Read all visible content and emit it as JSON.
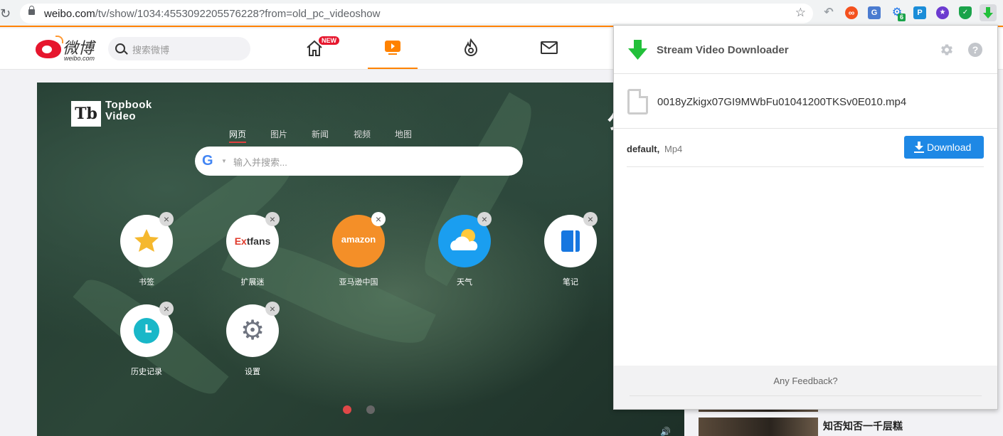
{
  "browser": {
    "url_host": "weibo.com",
    "url_path": "/tv/show/1034:4553092205576228?from=old_pc_videoshow",
    "extensions": [
      {
        "name": "back-arrow-icon",
        "color": "#9aa0a6"
      },
      {
        "name": "infinity-icon",
        "color": "#f4511e"
      },
      {
        "name": "translate-icon",
        "color": "#4a7bd0"
      },
      {
        "name": "gear-badge-icon",
        "color": "#1a73e8",
        "badge": "6"
      },
      {
        "name": "p-extension-icon",
        "color": "#1a8dd8",
        "text": "P"
      },
      {
        "name": "star-extension-icon",
        "color": "#6c3bd0"
      },
      {
        "name": "shield-extension-icon",
        "color": "#1aa34a"
      },
      {
        "name": "stream-downloader-icon",
        "color": "#22c03a"
      }
    ]
  },
  "weibo": {
    "logo_text": "微博",
    "logo_sub": "weibo.com",
    "search_placeholder": "搜索微博",
    "new_badge": "NEW"
  },
  "video": {
    "brand_line1": "Topbook",
    "brand_line2": "Video",
    "brand_logo": "Tb",
    "clipped_text": "匀",
    "tabs": [
      "网页",
      "图片",
      "新闻",
      "视频",
      "地图"
    ],
    "search_placeholder": "输入并搜索...",
    "tiles": [
      {
        "label": "书签",
        "icon": "star-icon"
      },
      {
        "label": "扩展迷",
        "icon": "extfans-icon",
        "text_red": "Ex",
        "text_dark": "tfans"
      },
      {
        "label": "亚马逊中国",
        "icon": "amazon-icon",
        "text": "amazon"
      },
      {
        "label": "天气",
        "icon": "weather-icon"
      },
      {
        "label": "笔记",
        "icon": "notes-icon"
      },
      {
        "label": "历史记录",
        "icon": "clock-icon"
      },
      {
        "label": "设置",
        "icon": "settings-gear-icon"
      }
    ]
  },
  "sidebar": {
    "item_title": "知否知否一千层糕"
  },
  "popup": {
    "title": "Stream Video Downloader",
    "file_name": "0018yZkigx07GI9MWbFu01041200TKSv0E010.mp4",
    "format_quality": "default,",
    "format_type": "Mp4",
    "download_label": "Download",
    "feedback": "Any Feedback?",
    "accent_color": "#1e88e5",
    "icon_color": "#22c03a"
  }
}
